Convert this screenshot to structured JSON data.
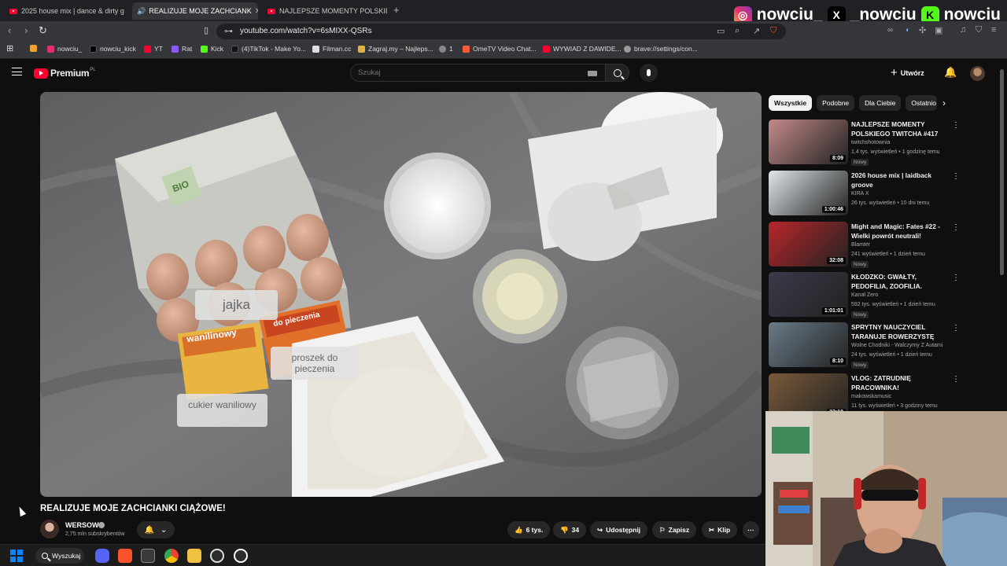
{
  "browser": {
    "tabs": [
      {
        "label": "2025 house mix | dance & dirty g",
        "active": false
      },
      {
        "label": "REALIZUJE MOJE ZACHCIANK",
        "active": true
      },
      {
        "label": "NAJLEPSZE MOMENTY POLSKIEGO T",
        "active": false
      }
    ],
    "new_tab": "+",
    "url": "youtube.com/watch?v=6sMIXX-QSRs",
    "bookmarks": [
      {
        "label": "",
        "color": "#f0a030"
      },
      {
        "label": "nowciu_",
        "color": "#e1306c"
      },
      {
        "label": "nowciu_kick",
        "color": "#000000"
      },
      {
        "label": "YT",
        "color": "#ff0033"
      },
      {
        "label": "Rat",
        "color": "#8a5cf6"
      },
      {
        "label": "Kick",
        "color": "#53fc18"
      },
      {
        "label": "(4)TikTok - Make Yo...",
        "color": "#111111"
      },
      {
        "label": "Filman.cc",
        "color": "#dddddd"
      },
      {
        "label": "Zagraj.my – Najleps...",
        "color": "#e0b040"
      },
      {
        "label": "1",
        "color": "#888888"
      },
      {
        "label": "OmeTV Video Chat...",
        "color": "#ff5a3c"
      },
      {
        "label": "WYWIAD Z DAWIDE...",
        "color": "#ff0033"
      },
      {
        "label": "brave://settings/con...",
        "color": "#999999"
      }
    ]
  },
  "overlay": {
    "instagram": "nowciu_",
    "x": "_nowciu",
    "kick": "nowciu"
  },
  "header": {
    "logo": "Premium",
    "logo_sup": "PL",
    "search_placeholder": "Szukaj",
    "create_label": "Utwórz"
  },
  "video": {
    "title": "REALIZUJE MOJE ZACHCIANKI CIĄŻOWE!",
    "labels": {
      "eggs": "jajka",
      "baking_powder": "proszek do pieczenia",
      "vanilla_sugar": "cukier waniliowy",
      "pack_vanilla": "wanilinowy",
      "pack_baking": "do pieczenia",
      "bio": "BIO"
    }
  },
  "channel": {
    "name": "WERSOW",
    "subs": "2,75 mln subskrybentów"
  },
  "actions": {
    "likes": "6 tys.",
    "dislikes": "34",
    "share": "Udostępnij",
    "save": "Zapisz",
    "clip": "Klip",
    "more": "⋯"
  },
  "sidebar": {
    "chips": [
      "Wszystkie",
      "Podobne",
      "Dla Ciebie",
      "Ostatnio"
    ],
    "recommendations": [
      {
        "title": "NAJLEPSZE MOMENTY POLSKIEGO TWITCHA #417",
        "channel": "twitchshotownia",
        "meta": "1,4 tys. wyświetleń • 1 godzinę temu",
        "badge": "Nowy",
        "duration": "8:09",
        "thumb": "#c48a8a"
      },
      {
        "title": "2026 house mix | laidback groove",
        "channel": "KIRA X",
        "meta": "26 tys. wyświetleń • 10 dni temu",
        "badge": "",
        "duration": "1:00:46",
        "thumb": "#dfe6ea"
      },
      {
        "title": "Might and Magic: Fates #22 - Wielki powrót neutrali!",
        "channel": "Blamter",
        "meta": "241 wyświetleń • 1 dzień temu",
        "badge": "Nowy",
        "duration": "32:08",
        "thumb": "#b8262a"
      },
      {
        "title": "KŁODZKO: GWAŁTY, PEDOFILIA, ZOOFILIA. WSTRZĄSAJĄCE ...",
        "channel": "Kanał Zero",
        "meta": "592 tys. wyświetleń • 1 dzień temu",
        "badge": "Nowy",
        "duration": "1:01:01",
        "thumb": "#3a3a4a"
      },
      {
        "title": "SPRYTNY NAUCZYCIEL TARANUJE ROWERZYSTĘ PO...",
        "channel": "Wolne Chodniki - Walczymy Z Autami",
        "meta": "24 tys. wyświetleń • 1 dzień temu",
        "badge": "Nowy",
        "duration": "8:10",
        "thumb": "#6a7b88"
      },
      {
        "title": "VLOG: ZATRUDNIĘ PRACOWNIKA!",
        "channel": "makowskamusic",
        "meta": "11 tys. wyświetleń • 3 godziny temu",
        "badge": "",
        "duration": "23:10",
        "thumb": "#7a5a3a"
      }
    ]
  },
  "taskbar": {
    "search_label": "Wyszukaj"
  }
}
